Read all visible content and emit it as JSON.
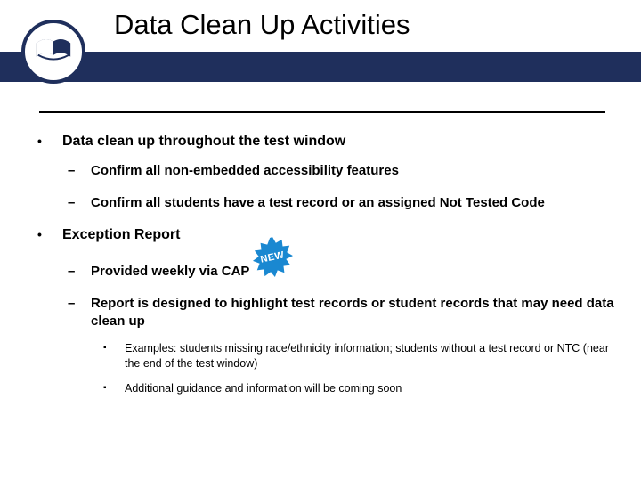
{
  "header": {
    "title": "Data Clean Up Activities"
  },
  "badge": {
    "label": "NEW"
  },
  "bullets": {
    "b1": {
      "text": "Data clean up throughout the test window",
      "sub": {
        "s1": "Confirm all non-embedded accessibility features",
        "s2": "Confirm all students have a test record or an assigned Not Tested Code"
      }
    },
    "b2": {
      "text": "Exception Report",
      "sub": {
        "s1": "Provided weekly via CAP",
        "s2": {
          "text": "Report is designed to highlight test records or student records that may need data clean up",
          "sub": {
            "e1": "Examples: students missing race/ethnicity information; students without a test record or NTC (near the end of the test window)",
            "e2": "Additional guidance and information will be coming soon"
          }
        }
      }
    }
  }
}
